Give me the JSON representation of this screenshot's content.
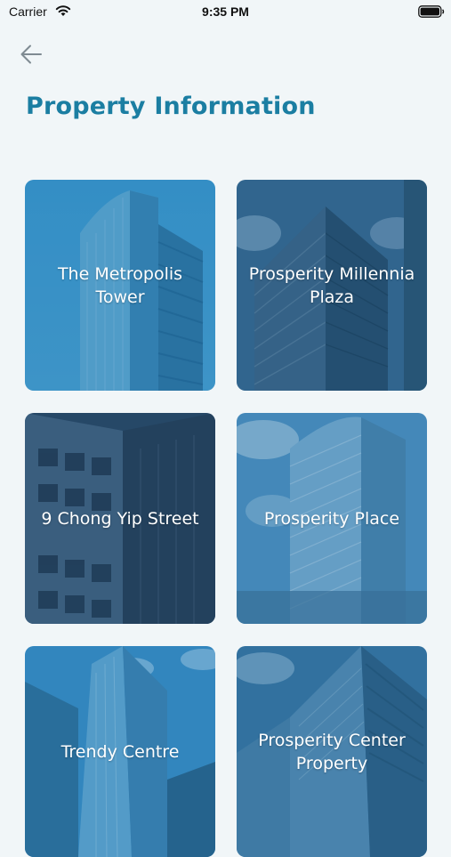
{
  "status_bar": {
    "carrier": "Carrier",
    "time": "9:35 PM",
    "icons": [
      "wifi-icon",
      "battery-icon"
    ]
  },
  "header": {
    "back_icon": "arrow-left-icon",
    "title": "Property Information"
  },
  "colors": {
    "title": "#1b7ea2",
    "background": "#f1f6f8",
    "card_overlay": "#1f6fa3"
  },
  "properties": [
    {
      "label": "The Metropolis Tower"
    },
    {
      "label": "Prosperity Millennia Plaza"
    },
    {
      "label": "9 Chong Yip Street"
    },
    {
      "label": "Prosperity Place"
    },
    {
      "label": "Trendy Centre"
    },
    {
      "label": "Prosperity Center Property"
    }
  ]
}
